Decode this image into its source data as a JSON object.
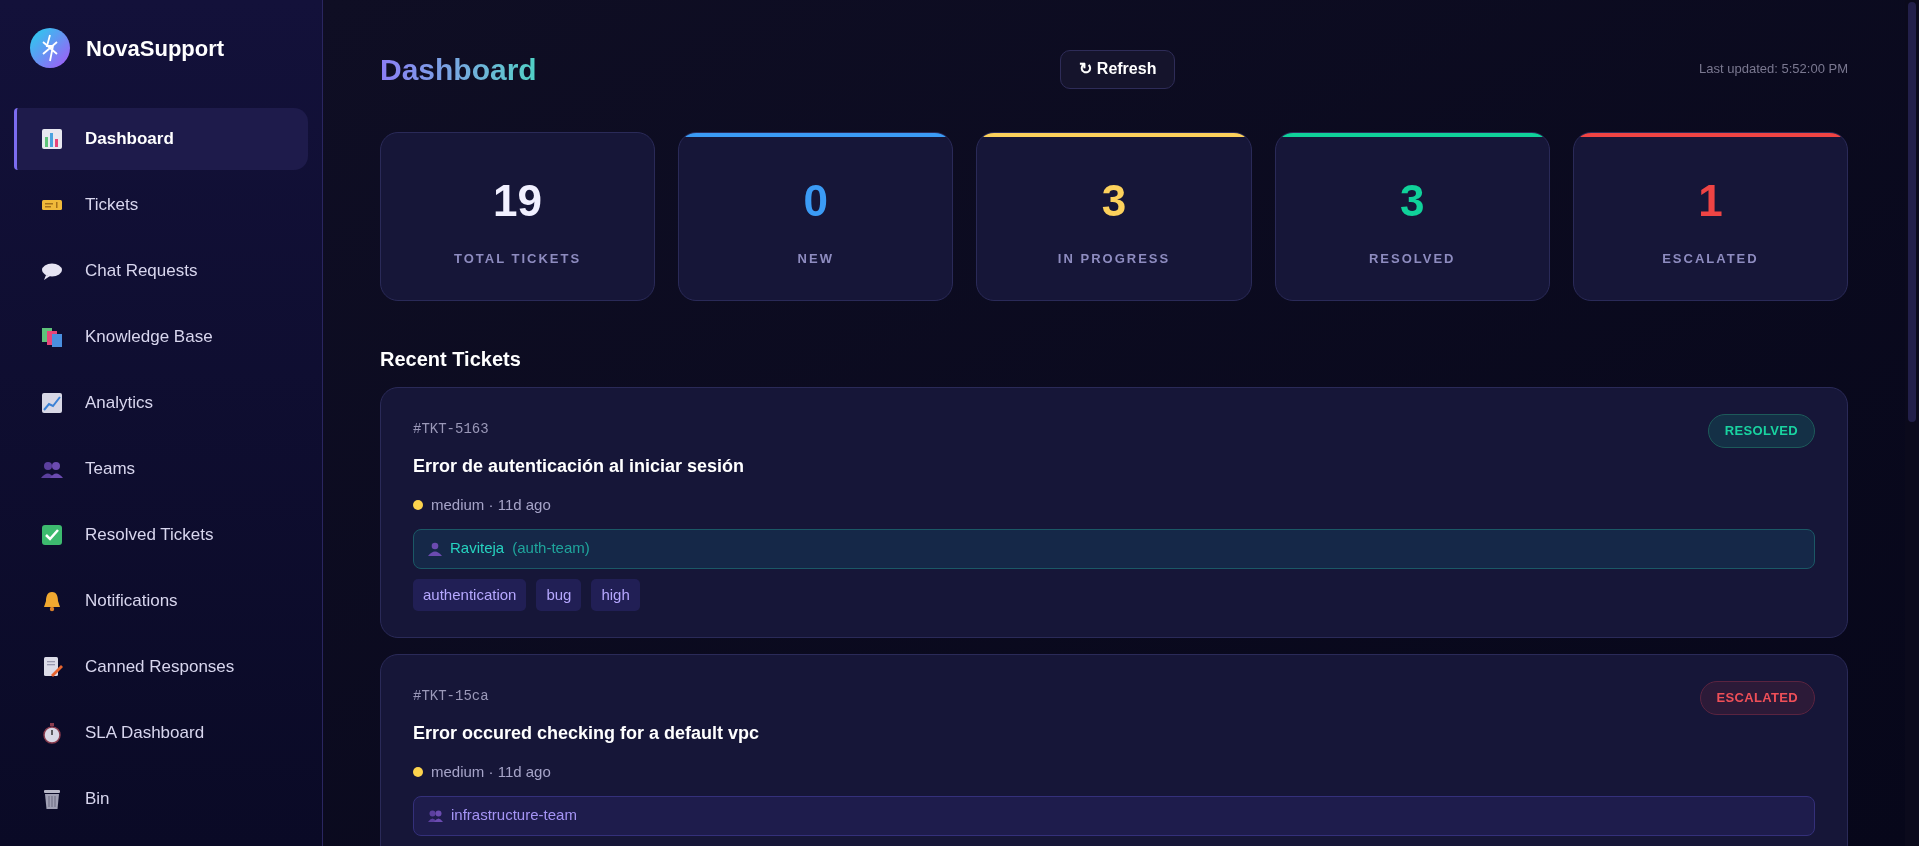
{
  "brand": {
    "name": "NovaSupport"
  },
  "sidebar": {
    "items": [
      {
        "label": "Dashboard",
        "selected": true
      },
      {
        "label": "Tickets",
        "selected": false
      },
      {
        "label": "Chat Requests",
        "selected": false
      },
      {
        "label": "Knowledge Base",
        "selected": false
      },
      {
        "label": "Analytics",
        "selected": false
      },
      {
        "label": "Teams",
        "selected": false
      },
      {
        "label": "Resolved Tickets",
        "selected": false
      },
      {
        "label": "Notifications",
        "selected": false
      },
      {
        "label": "Canned Responses",
        "selected": false
      },
      {
        "label": "SLA Dashboard",
        "selected": false
      },
      {
        "label": "Bin",
        "selected": false
      }
    ]
  },
  "header": {
    "title": "Dashboard",
    "refresh_button": "↻ Refresh",
    "last_updated": "Last updated: 5:52:00 PM"
  },
  "stats": [
    {
      "value": "19",
      "label": "TOTAL TICKETS",
      "color": "#f1f0ff"
    },
    {
      "value": "0",
      "label": "NEW",
      "color": "#3b9bf5"
    },
    {
      "value": "3",
      "label": "IN PROGRESS",
      "color": "#fcd15c"
    },
    {
      "value": "3",
      "label": "RESOLVED",
      "color": "#10d19a"
    },
    {
      "value": "1",
      "label": "ESCALATED",
      "color": "#ef4444"
    }
  ],
  "recent_tickets": {
    "title": "Recent Tickets",
    "tickets": [
      {
        "id": "#TKT-5163",
        "status": {
          "label": "RESOLVED",
          "kind": "resolved"
        },
        "title": "Error de autenticación al iniciar sesión",
        "priority": {
          "color": "#fcd34d",
          "text": "medium · 11d ago"
        },
        "assignee": {
          "kind": "agent",
          "name": "Raviteja",
          "team": "(auth-team)"
        },
        "tags": [
          "authentication",
          "bug",
          "high"
        ]
      },
      {
        "id": "#TKT-15ca",
        "status": {
          "label": "ESCALATED",
          "kind": "escalated"
        },
        "title": "Error occured checking for a default vpc",
        "priority": {
          "color": "#fcd34d",
          "text": "medium · 11d ago"
        },
        "assignee": {
          "kind": "team",
          "name": "infrastructure-team"
        }
      }
    ]
  }
}
